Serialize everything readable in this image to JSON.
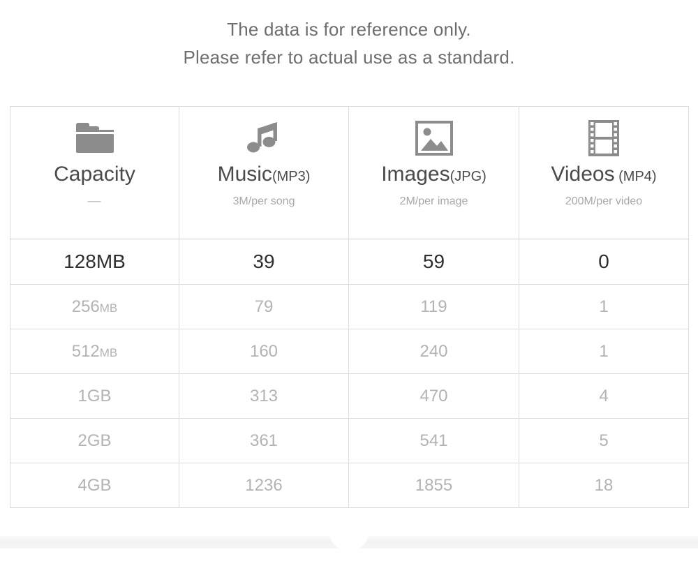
{
  "notice": {
    "line1": "The data is for reference only.",
    "line2": "Please refer to actual use as a standard."
  },
  "table": {
    "columns": [
      {
        "id": "capacity",
        "icon": "folder-icon",
        "label": "Capacity",
        "format": "",
        "sublabel": "—"
      },
      {
        "id": "music",
        "icon": "music-note-icon",
        "label": "Music",
        "format": "(MP3)",
        "sublabel": "3M/per song"
      },
      {
        "id": "images",
        "icon": "image-icon",
        "label": "Images",
        "format": "(JPG)",
        "sublabel": "2M/per image"
      },
      {
        "id": "videos",
        "icon": "film-strip-icon",
        "label": "Videos",
        "format": " (MP4)",
        "sublabel": "200M/per video"
      }
    ],
    "rows": [
      {
        "capacity_value": "128",
        "capacity_unit": "MB",
        "music": "39",
        "images": "59",
        "videos": "0",
        "highlight": true
      },
      {
        "capacity_value": "256",
        "capacity_unit": "MB",
        "music": "79",
        "images": "119",
        "videos": "1",
        "highlight": false
      },
      {
        "capacity_value": "512",
        "capacity_unit": "MB",
        "music": "160",
        "images": "240",
        "videos": "1",
        "highlight": false
      },
      {
        "capacity_value": "1",
        "capacity_unit": "GB",
        "music": "313",
        "images": "470",
        "videos": "4",
        "highlight": false
      },
      {
        "capacity_value": "2",
        "capacity_unit": "GB",
        "music": "361",
        "images": "541",
        "videos": "5",
        "highlight": false
      },
      {
        "capacity_value": "4",
        "capacity_unit": "GB",
        "music": "1236",
        "images": "1855",
        "videos": "18",
        "highlight": false
      }
    ]
  },
  "colors": {
    "notice_text": "#6e6e6e",
    "header_label": "#4a4a4a",
    "header_sub": "#a8a8a8",
    "icon": "#8c8c8c",
    "data_text": "#b3b3b3",
    "data_text_primary": "#2f2f2f",
    "border": "#dcdcdc"
  }
}
